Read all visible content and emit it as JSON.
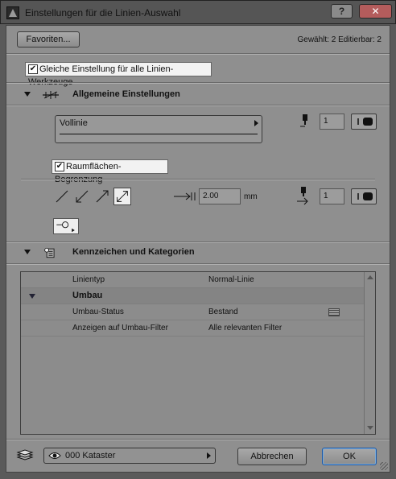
{
  "window": {
    "title": "Einstellungen für die Linien-Auswahl",
    "help_label": "?",
    "close_label": "✕"
  },
  "toolbar": {
    "favorites_label": "Favoriten...",
    "selection_info": "Gewählt: 2 Editierbar: 2"
  },
  "same_settings": {
    "label": "Gleiche Einstellung für alle Linien-Werkzeuge",
    "checked": true
  },
  "general": {
    "title": "Allgemeine Einstellungen",
    "line_type": "Vollinie",
    "pen_number_top": "1",
    "zone_boundary": {
      "label": "Raumflächen-Begrenzung",
      "checked": true
    },
    "arrow_size": "2.00",
    "arrow_unit": "mm",
    "pen_number_arrow": "1"
  },
  "categories": {
    "title": "Kennzeichen und Kategorien",
    "rows": [
      {
        "label": "Linientyp",
        "value": "Normal-Linie"
      },
      {
        "group": "Umbau"
      },
      {
        "label": "Umbau-Status",
        "value": "Bestand",
        "icon": "brick-pattern-icon"
      },
      {
        "label": "Anzeigen auf Umbau-Filter",
        "value": "Alle relevanten Filter"
      }
    ]
  },
  "footer": {
    "layer": "000 Kataster",
    "cancel_label": "Abbrechen",
    "ok_label": "OK"
  }
}
